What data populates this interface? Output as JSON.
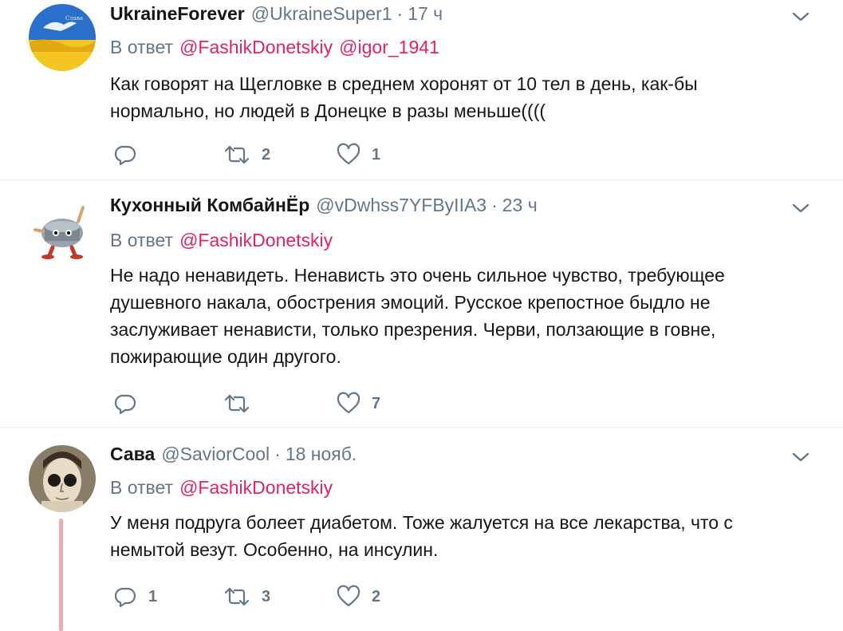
{
  "tweets": [
    {
      "name": "UkraineForever",
      "handle": "@UkraineSuper1",
      "separator": "·",
      "time": "17 ч",
      "reply_prefix": "В ответ",
      "mentions": [
        "@FashikDonetskiy",
        "@igor_1941"
      ],
      "text": "Как говорят на Щегловке в среднем хоронят от 10 тел в день, как-бы нормально, но людей в Донецке в разы меньше((((",
      "reply_count": "",
      "retweet_count": "2",
      "like_count": "1"
    },
    {
      "name": "Кухонный КомбайнЁр",
      "handle": "@vDwhss7YFByIIA3",
      "separator": "·",
      "time": "23 ч",
      "reply_prefix": "В ответ",
      "mentions": [
        "@FashikDonetskiy"
      ],
      "text": "Не надо ненавидеть. Ненависть это  очень сильное чувство, требующее душевного накала, обострения эмоций. Русское крепостное быдло не заслуживает ненависти, только презрения. Черви, ползающие в говне, пожирающие один другого.",
      "reply_count": "",
      "retweet_count": "",
      "like_count": "7"
    },
    {
      "name": "Сава",
      "handle": "@SaviorCool",
      "separator": "·",
      "time": "18 нояб.",
      "reply_prefix": "В ответ",
      "mentions": [
        "@FashikDonetskiy"
      ],
      "text": "У меня подруга болеет диабетом. Тоже жалуется на все лекарства, что с немытой везут. Особенно, на инсулин.",
      "reply_count": "1",
      "retweet_count": "3",
      "like_count": "2"
    }
  ],
  "icons": {
    "reply": "reply-icon",
    "retweet": "retweet-icon",
    "like": "heart-icon",
    "more": "chevron-down-icon"
  },
  "colors": {
    "mention": "#e0245e",
    "secondary": "#657786",
    "divider": "#e6ecf0",
    "thread_line": "#f1a9b8"
  }
}
